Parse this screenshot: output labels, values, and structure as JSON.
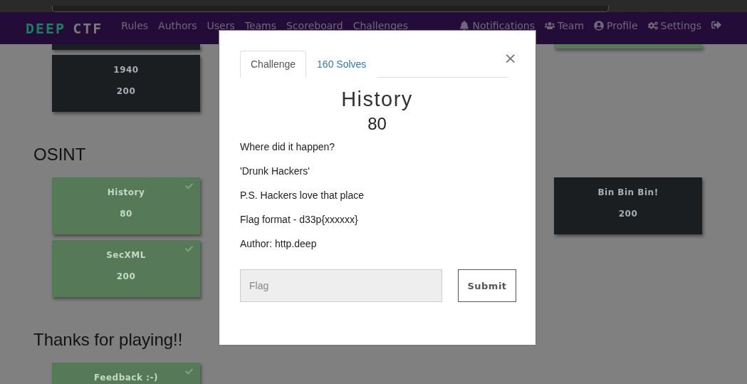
{
  "navbar": {
    "logo": {
      "part_1": "DEEP",
      "part_2": "CTF"
    },
    "links": [
      {
        "label": "Rules"
      },
      {
        "label": "Authors"
      },
      {
        "label": "Users"
      },
      {
        "label": "Teams"
      },
      {
        "label": "Scoreboard"
      },
      {
        "label": "Challenges"
      }
    ],
    "user_links": [
      {
        "kind": "notifications",
        "label": "Notifications"
      },
      {
        "kind": "team",
        "label": "Team"
      },
      {
        "kind": "profile",
        "label": "Profile"
      },
      {
        "kind": "settings",
        "label": "Settings"
      },
      {
        "kind": "logout"
      }
    ]
  },
  "top_stubs": {
    "left": {
      "solved": false
    },
    "right": {
      "solved": true
    }
  },
  "sections": [
    {
      "left_cards": [
        {
          "name": "1940",
          "value": "200",
          "solved": false
        }
      ]
    },
    {
      "title": "OSINT",
      "left_cards": [
        {
          "name": "History",
          "value": "80",
          "solved": true
        },
        {
          "name": "SecXML",
          "value": "200",
          "solved": true
        }
      ],
      "right_cards": [
        {
          "name": "Bin Bin Bin!",
          "value": "200",
          "solved": false
        }
      ]
    },
    {
      "title": "Thanks for playing!!",
      "left_cards": [
        {
          "name": "Feedback :-)",
          "solved": true
        }
      ]
    }
  ],
  "modal": {
    "tabs": [
      {
        "label": "Challenge",
        "selected": true
      },
      {
        "label": "160 Solves",
        "selected": false
      }
    ],
    "close": "×",
    "title": "History",
    "value": "80",
    "description": [
      "Where did it happen?",
      "'Drunk Hackers'",
      "P.S. Hackers love that place",
      "Flag format - d33p{xxxxxx}",
      "Author: http.deep"
    ],
    "flag_input": {
      "placeholder": "Flag"
    },
    "submit": "Submit"
  }
}
